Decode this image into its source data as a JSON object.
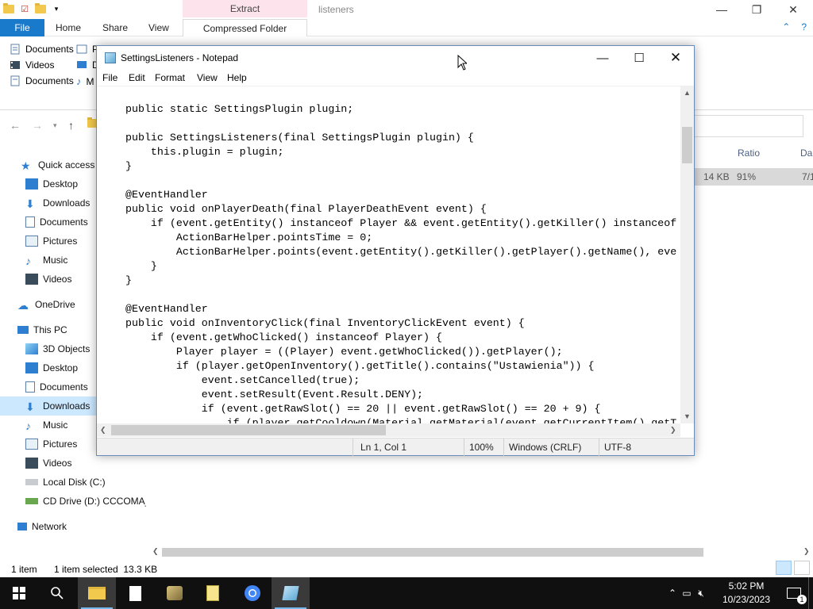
{
  "explorer": {
    "extract_tab": "Extract",
    "window_title": "listeners",
    "ribbon_tabs": [
      "File",
      "Home",
      "Share",
      "View",
      "Compressed Folder Tools"
    ],
    "ribbon_items": [
      "Documents",
      "Videos",
      "Documents"
    ],
    "ribbon_items_col2": [
      "P",
      "D",
      "M"
    ],
    "columns": [
      "Ratio",
      "Da"
    ],
    "file_row": {
      "size": "14 KB",
      "ratio": "91%",
      "date": "7/1"
    },
    "nav": {
      "quick_access": "Quick access",
      "qa_items": [
        "Desktop",
        "Downloads",
        "Documents",
        "Pictures",
        "Music",
        "Videos"
      ],
      "onedrive": "OneDrive",
      "this_pc": "This PC",
      "pc_items": [
        "3D Objects",
        "Desktop",
        "Documents",
        "Downloads",
        "Music",
        "Pictures",
        "Videos",
        "Local Disk (C:)",
        "CD Drive (D:) CCCOMA_X"
      ],
      "network": "Network"
    },
    "status": {
      "count": "1 item",
      "selected": "1 item selected  13.3 KB"
    }
  },
  "notepad": {
    "title": "SettingsListeners - Notepad",
    "menu": [
      "File",
      "Edit",
      "Format",
      "View",
      "Help"
    ],
    "code_lines": [
      "public static SettingsPlugin plugin;",
      "",
      "public SettingsListeners(final SettingsPlugin plugin) {",
      "    this.plugin = plugin;",
      "}",
      "",
      "@EventHandler",
      "public void onPlayerDeath(final PlayerDeathEvent event) {",
      "    if (event.getEntity() instanceof Player && event.getEntity().getKiller() instanceof",
      "        ActionBarHelper.pointsTime = 0;",
      "        ActionBarHelper.points(event.getEntity().getKiller().getPlayer().getName(), eve",
      "    }",
      "}",
      "",
      "@EventHandler",
      "public void onInventoryClick(final InventoryClickEvent event) {",
      "    if (event.getWhoClicked() instanceof Player) {",
      "        Player player = ((Player) event.getWhoClicked()).getPlayer();",
      "        if (player.getOpenInventory().getTitle().contains(\"Ustawienia\")) {",
      "            event.setCancelled(true);",
      "            event.setResult(Event.Result.DENY);",
      "            if (event.getRawSlot() == 20 || event.getRawSlot() == 20 + 9) {",
      "                if (player.getCooldown(Material.getMaterial(event.getCurrentItem().getT"
    ],
    "status": {
      "position": "Ln 1, Col 1",
      "zoom": "100%",
      "line_ending": "Windows (CRLF)",
      "encoding": "UTF-8"
    }
  },
  "taskbar": {
    "time": "5:02 PM",
    "date": "10/23/2023",
    "notification_count": "1"
  }
}
